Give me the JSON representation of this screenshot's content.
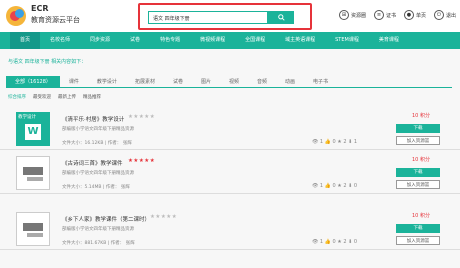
{
  "brand": {
    "line1": "ECR",
    "line2": "教育资源云平台"
  },
  "search": {
    "value": "语文 四年级下册",
    "button_icon": "search-icon"
  },
  "tools": [
    {
      "icon": "resource-library-icon",
      "label": "资源圈"
    },
    {
      "icon": "certificate-icon",
      "label": "证书"
    },
    {
      "icon": "user-icon",
      "label": "单页"
    },
    {
      "icon": "logout-icon",
      "label": "退出"
    }
  ],
  "nav": [
    "首页",
    "名校名师",
    "同步资源",
    "试卷",
    "特色专题",
    "微视频课程",
    "全国课程",
    "域主英语课程",
    "STEM课程",
    "美育课程"
  ],
  "crumb": "与语文 四年级下册 相关内容如下：",
  "filters": [
    "全部（16128）",
    "课件",
    "教学设计",
    "拓展素材",
    "试卷",
    "图片",
    "视频",
    "音频",
    "动画",
    "电子书"
  ],
  "sorts": [
    "综合排序",
    "最受欢迎",
    "最新上传",
    "精品推荐"
  ],
  "items": [
    {
      "title": "《清平乐·村居》教学设计",
      "stars": "★★★★★",
      "desc": "部编版小学语文四年级下册精品资源",
      "meta": "文件大小：16.12KB | 作者：  张辉",
      "stats": "👁 1   👍 0   ★ 2   ⬇ 1",
      "price": "10 积分",
      "download": "下载",
      "add": "加入资源篮",
      "thumb_label": "教学设计",
      "thumb_letter": "W"
    },
    {
      "title": "《古诗词三首》教学课件",
      "stars": "★★★★★",
      "desc": "部编版小学语文四年级下册精品资源",
      "meta": "文件大小：5.14MB | 作者：  张辉",
      "stats": "👁 1   👍 0   ★ 2   ⬇ 0",
      "price": "10 积分",
      "download": "下载",
      "add": "加入资源篮"
    },
    {
      "title": "《乡下人家》教学课件（第二课时）",
      "stars": "★★★★★",
      "desc": "部编版小学语文四年级下册精品资源",
      "meta": "文件大小：881.67KB | 作者：  张辉",
      "stats": "👁 1   👍 0   ★ 2   ⬇ 0",
      "price": "10 积分",
      "download": "下载",
      "add": "加入资源篮"
    }
  ]
}
